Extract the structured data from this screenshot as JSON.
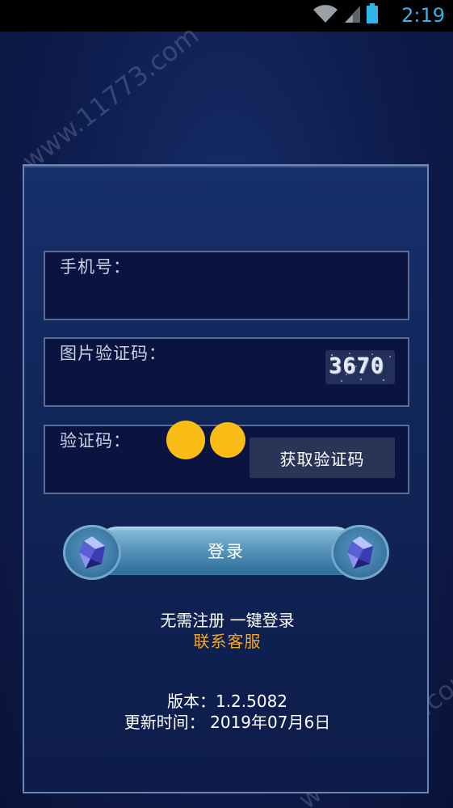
{
  "status_bar": {
    "time": "2:19",
    "icons": [
      "wifi-icon",
      "signal-icon",
      "battery-icon"
    ]
  },
  "login_form": {
    "phone_label": "手机号：",
    "image_captcha_label": "图片验证码：",
    "captcha_value": "3670",
    "code_label": "验证码：",
    "get_code_label": "获取验证码",
    "login_label": "登录"
  },
  "footer": {
    "no_register": "无需注册 一键登录",
    "contact_service": "联系客服",
    "version": "版本：1.2.5082",
    "update_time": "更新时间： 2019年07月6日"
  },
  "watermark": "www.11773.com",
  "colors": {
    "accent_orange": "#f5a623",
    "status_blue": "#33b5e5",
    "overlay_dot": "#f9bd16"
  }
}
